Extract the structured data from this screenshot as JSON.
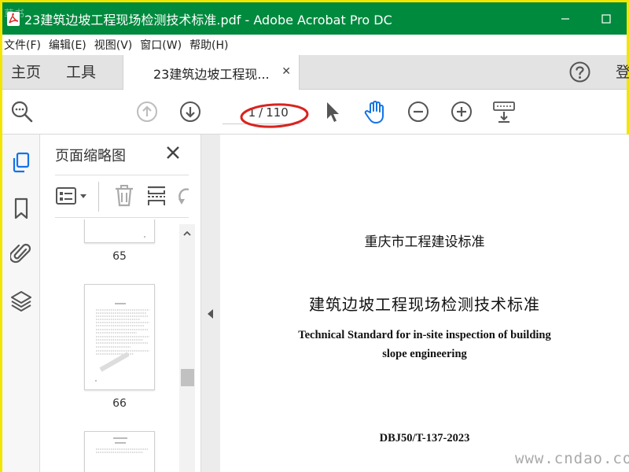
{
  "window": {
    "title": "23建筑边坡工程现场检测技术标准.pdf - Adobe Acrobat Pro DC",
    "title_bar_color": "#008a3e"
  },
  "menu": [
    "文件(F)",
    "编辑(E)",
    "视图(V)",
    "窗口(W)",
    "帮助(H)"
  ],
  "tabs": {
    "home": "主页",
    "tools": "工具",
    "document": "23建筑边坡工程现...",
    "login": "登"
  },
  "toolbar": {
    "current_page": "1",
    "page_separator": "/",
    "total_pages": "110",
    "icons": [
      "search-icon",
      "prev-page-icon",
      "next-page-icon",
      "select-cursor-icon",
      "hand-tool-icon",
      "zoom-out-icon",
      "zoom-in-icon",
      "keyboard-icon"
    ]
  },
  "sidebar": {
    "panel_title": "页面缩略图",
    "rail_icons": [
      "page-thumbnails-icon",
      "bookmark-icon",
      "attachment-icon",
      "layers-icon"
    ],
    "thumbnails": [
      {
        "page_label": "65"
      },
      {
        "page_label": "66"
      },
      {
        "page_label": ""
      }
    ]
  },
  "document": {
    "org": "重庆市工程建设标准",
    "title_cn": "建筑边坡工程现场检测技术标准",
    "title_en_line1": "Technical Standard for in-site inspection of building",
    "title_en_line2": "slope engineering",
    "code": "DBJ50/T-137-2023"
  },
  "watermarks": {
    "bottom_right": "www.cndao.com",
    "top_left": "草书"
  },
  "colors": {
    "accent_blue": "#1473e6",
    "annotation_red": "#d9231f",
    "highlight_border": "#f2e500"
  }
}
